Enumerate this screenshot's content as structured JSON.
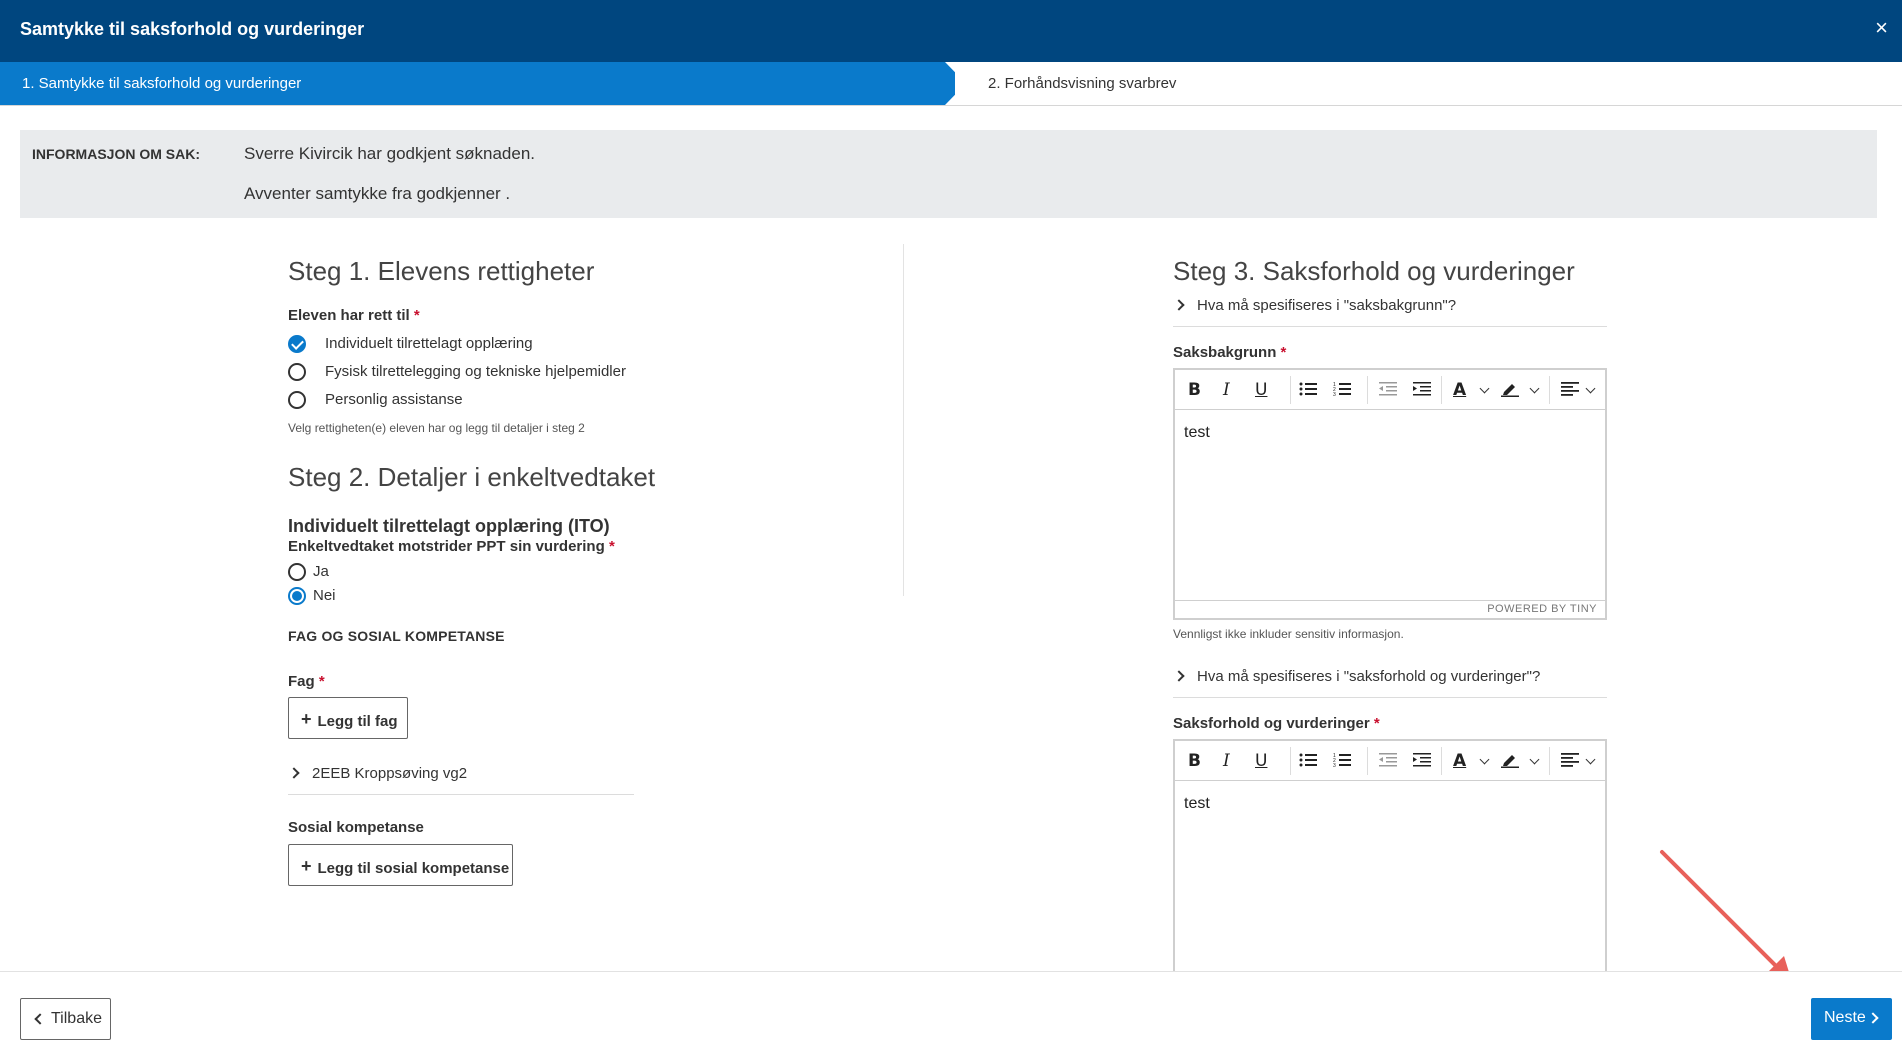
{
  "dialog": {
    "title": "Samtykke til saksforhold og vurderinger",
    "close_glyph": "×"
  },
  "stepper": {
    "steps": [
      {
        "label": "1. Samtykke til saksforhold og vurderinger",
        "active": true
      },
      {
        "label": "2. Forhåndsvisning svarbrev",
        "active": false
      }
    ]
  },
  "info": {
    "label": "INFORMASJON OM SAK:",
    "lines": [
      "Sverre Kivircik har godkjent søknaden.",
      "Avventer samtykke fra godkjenner ."
    ]
  },
  "steg1": {
    "title": "Steg 1. Elevens rettigheter",
    "field_label": "Eleven har rett til",
    "required_mark": "*",
    "options": [
      {
        "label": "Individuelt tilrettelagt opplæring",
        "checked": true
      },
      {
        "label": "Fysisk tilrettelegging og tekniske hjelpemidler",
        "checked": false
      },
      {
        "label": "Personlig assistanse",
        "checked": false
      }
    ],
    "hint": "Velg rettigheten(e) eleven har og legg til detaljer i steg 2"
  },
  "steg2": {
    "title": "Steg 2. Detaljer i enkeltvedtaket",
    "subtitle": "Individuelt tilrettelagt opplæring (ITO)",
    "question": "Enkeltvedtaket motstrider PPT sin vurdering",
    "required_mark": "*",
    "radios": [
      {
        "label": "Ja",
        "checked": false
      },
      {
        "label": "Nei",
        "checked": true
      }
    ],
    "section_caps": "FAG OG SOSIAL KOMPETANSE",
    "fag_label": "Fag",
    "add_fag": "Legg til fag",
    "fag_items": [
      "2EEB Kroppsøving vg2"
    ],
    "sosial_label": "Sosial kompetanse",
    "add_sosial": "Legg til sosial kompetanse"
  },
  "steg3": {
    "title": "Steg 3. Saksforhold og vurderinger",
    "help1": "Hva må spesifiseres i \"saksbakgrunn\"?",
    "field1_label": "Saksbakgrunn",
    "field1_value": "test",
    "powered_by": "POWERED BY TINY",
    "note": "Vennligst ikke inkluder sensitiv informasjon.",
    "help2": "Hva må spesifiseres i \"saksforhold og vurderinger\"?",
    "field2_label": "Saksforhold og vurderinger",
    "field2_value": "test",
    "required_mark": "*"
  },
  "toolbar": {
    "bold": "B",
    "italic": "I",
    "underline": "U",
    "font_color": "A"
  },
  "footer": {
    "back": "Tilbake",
    "next": "Neste"
  },
  "colors": {
    "header": "#00467f",
    "accent": "#0a7acb",
    "required": "#c8102e",
    "annotation": "#e8605a"
  },
  "icons": [
    "close-icon",
    "checkbox-icon",
    "radio-icon",
    "plus-icon",
    "chevron-right-icon",
    "chevron-left-icon",
    "bullet-list-icon",
    "numbered-list-icon",
    "outdent-icon",
    "indent-icon",
    "text-color-icon",
    "highlight-icon",
    "align-icon"
  ]
}
